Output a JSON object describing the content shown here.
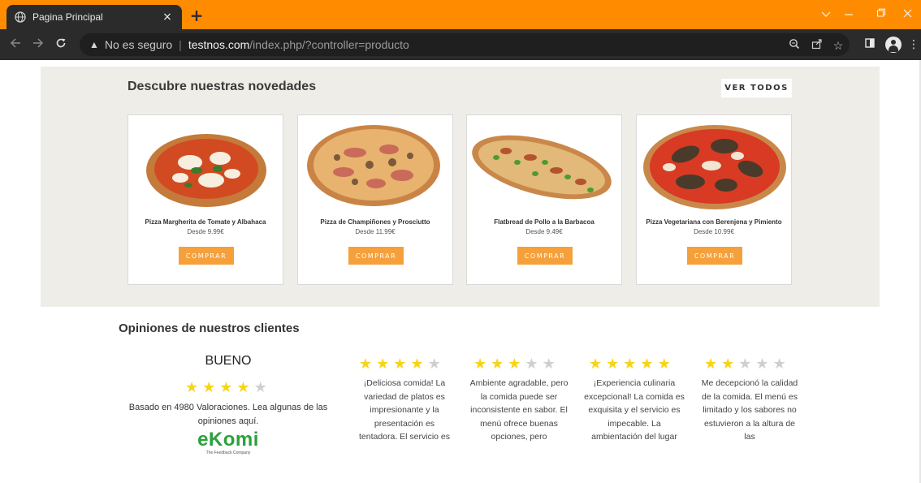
{
  "browser": {
    "tab_title": "Pagina Principal",
    "tab_close": "×",
    "new_tab": "+",
    "security_label": "No es seguro",
    "url_host": "testnos.com",
    "url_path": "/index.php/?controller=producto"
  },
  "novedades": {
    "title": "Descubre nuestras novedades",
    "ver_todos": "VER TODOS",
    "products": [
      {
        "name": "Pizza Margherita de Tomate y Albahaca",
        "price": "Desde 9.99€",
        "buy": "COMPRAR"
      },
      {
        "name": "Pizza de Champiñones y Prosciutto",
        "price": "Desde 11.99€",
        "buy": "COMPRAR"
      },
      {
        "name": "Flatbread de Pollo a la Barbacoa",
        "price": "Desde 9.49€",
        "buy": "COMPRAR"
      },
      {
        "name": "Pizza Vegetariana con Berenjena y Pimiento",
        "price": "Desde 10.99€",
        "buy": "COMPRAR"
      }
    ]
  },
  "opiniones": {
    "title": "Opiniones de nuestros clientes",
    "rating_word": "BUENO",
    "rating_stars": 4,
    "based_on": "Basado en 4980 Valoraciones. Lea algunas de las opiniones aquí.",
    "brand": "eKomi",
    "brand_tagline": "The Feedback Company",
    "reviews": [
      {
        "stars": 4,
        "text": "¡Deliciosa comida! La variedad de platos es impresionante y la presentación es tentadora. El servicio es"
      },
      {
        "stars": 3,
        "text": "Ambiente agradable, pero la comida puede ser inconsistente en sabor. El menú ofrece buenas opciones, pero"
      },
      {
        "stars": 5,
        "text": "¡Experiencia culinaria excepcional! La comida es exquisita y el servicio es impecable. La ambientación del lugar"
      },
      {
        "stars": 2,
        "text": "Me decepcionó la calidad de la comida. El menú es limitado y los sabores no estuvieron a la altura de las"
      }
    ]
  },
  "colors": {
    "tabbar": "#ff8c00",
    "section_bg": "#eeede8",
    "buy_button": "#f5a03a",
    "star_on": "#f7d417",
    "star_off": "#cfcfcf",
    "ekomi_green": "#2aa13b"
  }
}
